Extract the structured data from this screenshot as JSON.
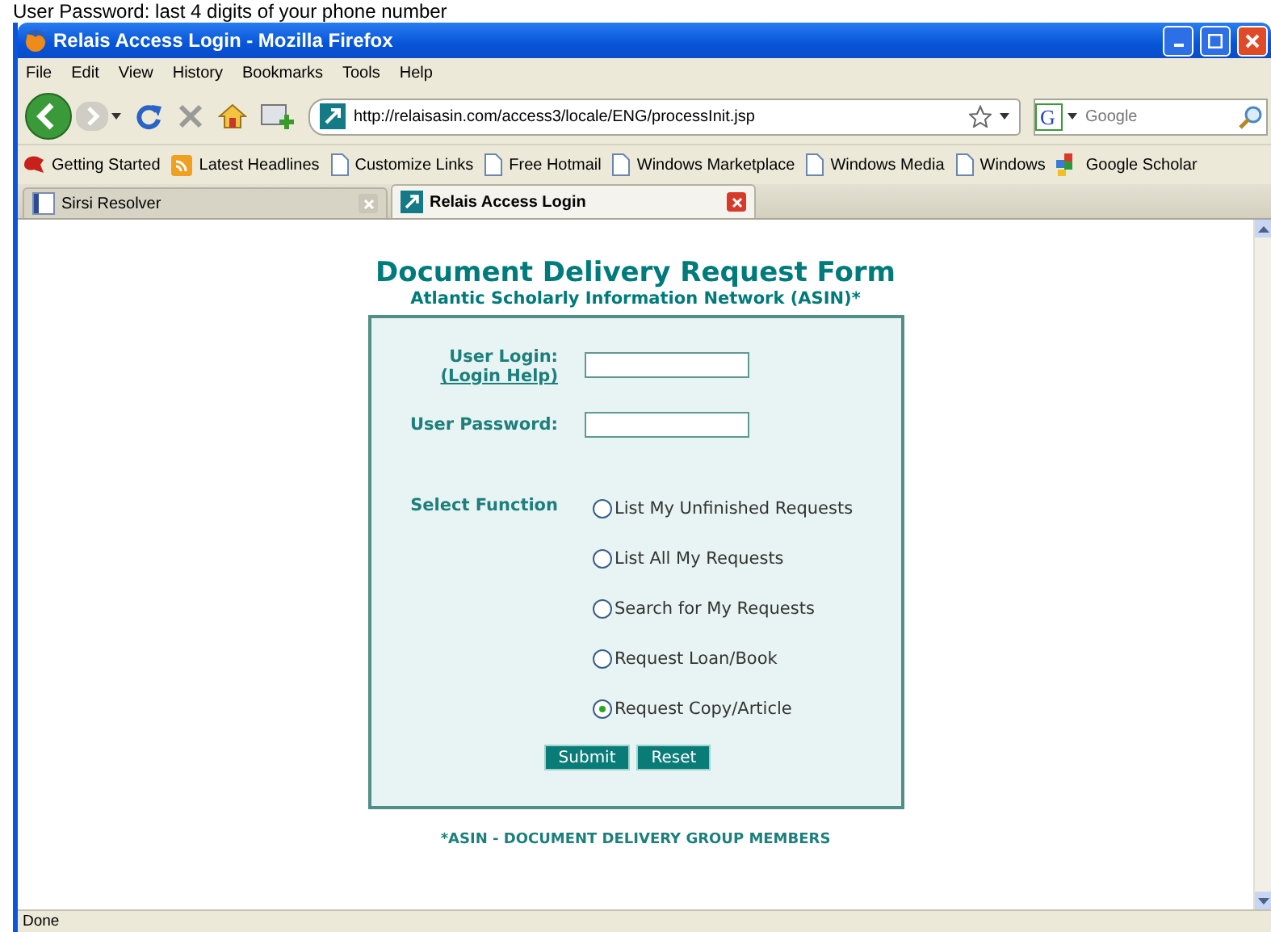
{
  "caption": "User Password: last 4 digits of your phone number",
  "window": {
    "title": "Relais Access Login - Mozilla Firefox"
  },
  "menu": [
    "File",
    "Edit",
    "View",
    "History",
    "Bookmarks",
    "Tools",
    "Help"
  ],
  "navbar": {
    "url": "http://relaisasin.com/access3/locale/ENG/processInit.jsp",
    "search_placeholder": "Google",
    "search_engine_letter": "G"
  },
  "bookmarks": [
    {
      "label": "Getting Started",
      "kind": "fox"
    },
    {
      "label": "Latest Headlines",
      "kind": "feed"
    },
    {
      "label": "Customize Links",
      "kind": "page"
    },
    {
      "label": "Free Hotmail",
      "kind": "page"
    },
    {
      "label": "Windows Marketplace",
      "kind": "page"
    },
    {
      "label": "Windows Media",
      "kind": "page"
    },
    {
      "label": "Windows",
      "kind": "page"
    },
    {
      "label": "Google Scholar",
      "kind": "scholar"
    }
  ],
  "tabs": [
    {
      "label": "Sirsi Resolver",
      "selected": false
    },
    {
      "label": "Relais Access Login",
      "selected": true
    }
  ],
  "form": {
    "title": "Document Delivery Request Form",
    "subtitle": "Atlantic Scholarly Information Network (ASIN)*",
    "login_label": "User Login:",
    "login_help": "(Login Help)",
    "password_label": "User Password:",
    "function_label": "Select Function",
    "options": [
      {
        "label": "List My Unfinished Requests",
        "selected": false
      },
      {
        "label": "List All My Requests",
        "selected": false
      },
      {
        "label": "Search for My Requests",
        "selected": false
      },
      {
        "label": "Request Loan/Book",
        "selected": false
      },
      {
        "label": "Request Copy/Article",
        "selected": true
      }
    ],
    "buttons": [
      "Submit",
      "Reset"
    ],
    "footnote": "*ASIN - DOCUMENT DELIVERY GROUP MEMBERS"
  },
  "status_bar": "Done"
}
